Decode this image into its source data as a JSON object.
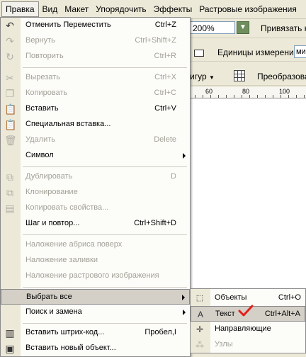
{
  "menubar": {
    "items": [
      "Правка",
      "Вид",
      "Макет",
      "Упорядочить",
      "Эффекты",
      "Растровые изображения"
    ]
  },
  "toolbar": {
    "zoom_value": "200%",
    "snap_label": "Привязать к",
    "units_label": "Единицы измерения:",
    "units_value": "ми",
    "shapes_label": "игур",
    "transform_label": "Преобразова"
  },
  "ruler": {
    "ticks": [
      "60",
      "80",
      "100"
    ]
  },
  "edit_menu": {
    "undo": {
      "label": "Отменить Переместить",
      "shortcut": "Ctrl+Z"
    },
    "redo": {
      "label": "Вернуть",
      "shortcut": "Ctrl+Shift+Z"
    },
    "repeat": {
      "label": "Повторить",
      "shortcut": "Ctrl+R"
    },
    "cut": {
      "label": "Вырезать",
      "shortcut": "Ctrl+X"
    },
    "copy": {
      "label": "Копировать",
      "shortcut": "Ctrl+C"
    },
    "paste": {
      "label": "Вставить",
      "shortcut": "Ctrl+V"
    },
    "paste_special": {
      "label": "Специальная вставка..."
    },
    "delete": {
      "label": "Удалить",
      "shortcut": "Delete"
    },
    "symbol": {
      "label": "Символ"
    },
    "duplicate": {
      "label": "Дублировать",
      "shortcut": "D"
    },
    "clone": {
      "label": "Клонирование"
    },
    "copy_properties": {
      "label": "Копировать свойства..."
    },
    "step_repeat": {
      "label": "Шаг и повтор...",
      "shortcut": "Ctrl+Shift+D"
    },
    "overprint_outline": {
      "label": "Наложение абриса поверх"
    },
    "overprint_fill": {
      "label": "Наложение заливки"
    },
    "overprint_bitmap": {
      "label": "Наложение растрового изображения"
    },
    "select_all": {
      "label": "Выбрать все"
    },
    "find_replace": {
      "label": "Поиск и замена"
    },
    "insert_barcode": {
      "label": "Вставить штрих-код...",
      "shortcut": "Пробел,I"
    },
    "insert_object": {
      "label": "Вставить новый объект..."
    }
  },
  "select_all_submenu": {
    "objects": {
      "label": "Объекты",
      "shortcut": "Ctrl+O"
    },
    "text": {
      "label": "Текст",
      "shortcut": "Ctrl+Alt+A"
    },
    "guides": {
      "label": "Направляющие"
    },
    "nodes": {
      "label": "Узлы"
    }
  },
  "colors": {
    "check_red": "#e0201c",
    "highlight": "#d4d0c8",
    "gutter": "#ece9d8"
  }
}
